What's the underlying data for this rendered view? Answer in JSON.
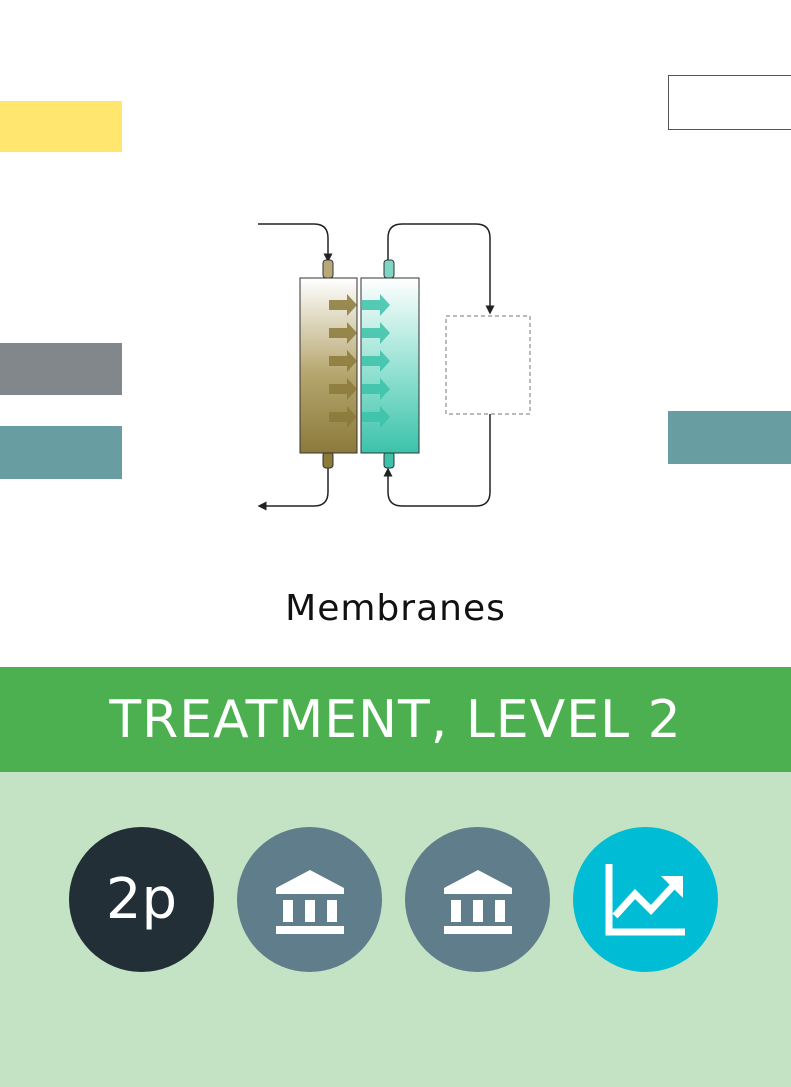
{
  "card": {
    "name": "Membranes",
    "category_title": "TREATMENT, LEVEL 2"
  },
  "badges": [
    {
      "label": "2p",
      "icon": "cost-badge",
      "bg": "#222f36"
    },
    {
      "label": "",
      "icon": "government-building-icon",
      "bg": "#607d8b"
    },
    {
      "label": "",
      "icon": "government-building-icon",
      "bg": "#607d8b"
    },
    {
      "label": "",
      "icon": "trending-up-chart-icon",
      "bg": "#00bcd4"
    }
  ],
  "colors": {
    "banner": "#4caf50",
    "footer": "#c3e3c4",
    "yellow_tab": "#ffe66e",
    "gray_tab": "#82878b",
    "teal_tab": "#689da2",
    "membrane_brown": "#8b7a3a",
    "membrane_teal": "#3cc2aa"
  }
}
